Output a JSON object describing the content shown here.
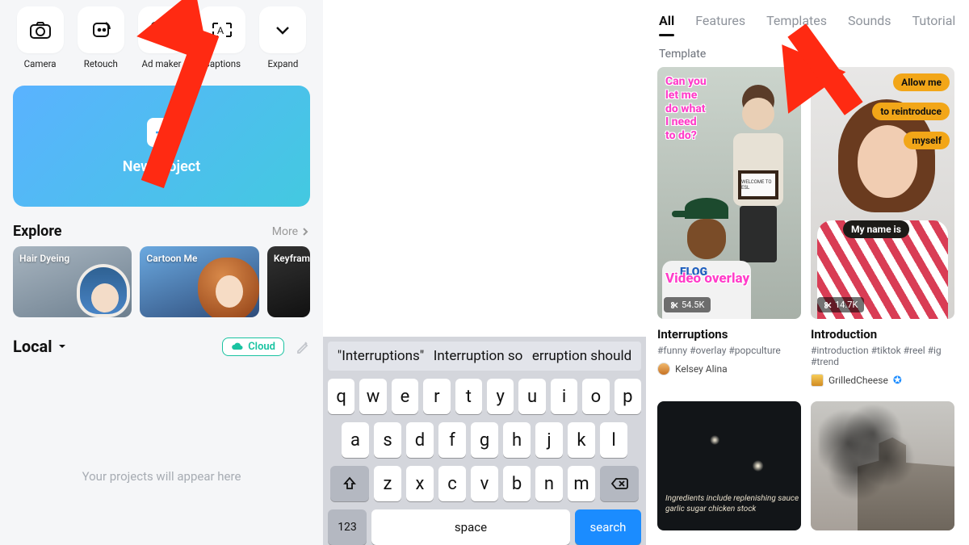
{
  "left": {
    "tools": [
      {
        "label": "Camera",
        "icon": "camera"
      },
      {
        "label": "Retouch",
        "icon": "retouch"
      },
      {
        "label": "Ad maker",
        "icon": "admaker"
      },
      {
        "label": "Captions",
        "icon": "captions"
      },
      {
        "label": "Expand",
        "icon": "expand"
      }
    ],
    "new_project": "New project",
    "explore": {
      "title": "Explore",
      "more": "More",
      "items": [
        "Hair Dyeing",
        "Cartoon Me",
        "Keyframe"
      ]
    },
    "local": {
      "title": "Local",
      "cloud": "Cloud"
    },
    "placeholder": "Your projects will appear here"
  },
  "keyboard": {
    "suggestions": [
      "\"Interruptions\"",
      "Interruption so",
      "erruption should"
    ],
    "row1": [
      "q",
      "w",
      "e",
      "r",
      "t",
      "y",
      "u",
      "i",
      "o",
      "p"
    ],
    "row2": [
      "a",
      "s",
      "d",
      "f",
      "g",
      "h",
      "j",
      "k",
      "l"
    ],
    "row3": [
      "z",
      "x",
      "c",
      "v",
      "b",
      "n",
      "m"
    ],
    "numkey": "123",
    "space": "space",
    "search": "search"
  },
  "right": {
    "tabs": [
      "All",
      "Features",
      "Templates",
      "Sounds",
      "Tutorial"
    ],
    "active_tab": "All",
    "section": "Template",
    "cards": [
      {
        "count": "54.5K",
        "title": "Interruptions",
        "tags": "#funny #overlay #popculture",
        "author": "Kelsey Alina",
        "overlay_text1": "Can you",
        "overlay_text2": "let me",
        "overlay_text3": "do what",
        "overlay_text4": "I need",
        "overlay_text5": "to do?",
        "overlay_vo": "Video overlay",
        "sign": "WELCOME TO ESL",
        "shirt": "FLOG"
      },
      {
        "count": "14.7K",
        "title": "Introduction",
        "tags": "#introduction #tiktok #reel #ig #trend",
        "author": "GrilledCheese",
        "pill1": "Allow me",
        "pill2": "to reintroduce",
        "pill3": "myself",
        "pill4": "My name is"
      }
    ],
    "recipe_text": "Ingredients include replenishing sauce garlic sugar chicken stock"
  }
}
